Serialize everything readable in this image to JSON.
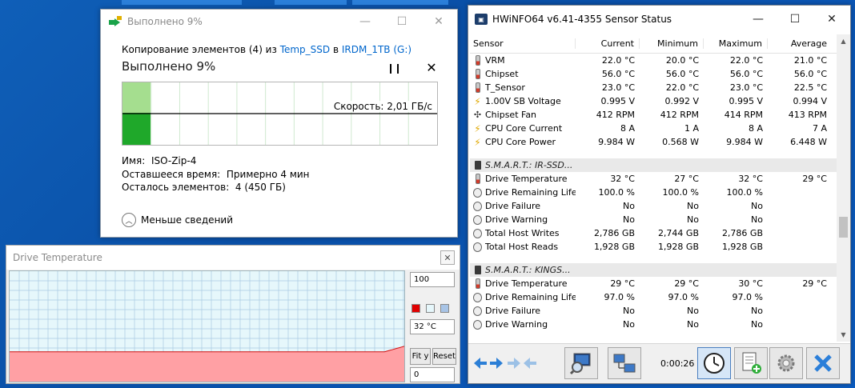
{
  "copy_dialog": {
    "title": "Выполнено 9%",
    "copy_prefix": "Копирование элементов (4) из ",
    "source": "Temp_SSD",
    "copy_mid": " в ",
    "destination": "IRDM_1TB (G:)",
    "heading": "Выполнено 9%",
    "speed": "Скорость: 2,01 ГБ/с",
    "progress": 0.09,
    "name_label": "Имя:",
    "name_value": "ISO-Zip-4",
    "time_label": "Оставшееся время:",
    "time_value": "Примерно 4 мин",
    "items_label": "Осталось элементов:",
    "items_value": "4 (450 ГБ)",
    "less_details": "Меньше сведений"
  },
  "temp_window": {
    "title": "Drive Temperature",
    "max_value": "100",
    "current_value": "32 °C",
    "min_value": "0",
    "fit_label": "Fit y",
    "reset_label": "Reset",
    "colors": {
      "line": "#d01010",
      "fill": "#ffa0a4",
      "background": "#e6f7fb"
    }
  },
  "hwinfo": {
    "title": "HWiNFO64 v6.41-4355 Sensor Status",
    "columns": [
      "Sensor",
      "Current",
      "Minimum",
      "Maximum",
      "Average"
    ],
    "rows": [
      {
        "icon": "thermo",
        "name": "VRM",
        "current": "22.0 °C",
        "min": "20.0 °C",
        "max": "22.0 °C",
        "avg": "21.0 °C"
      },
      {
        "icon": "thermo",
        "name": "Chipset",
        "current": "56.0 °C",
        "min": "56.0 °C",
        "max": "56.0 °C",
        "avg": "56.0 °C"
      },
      {
        "icon": "thermo",
        "name": "T_Sensor",
        "current": "23.0 °C",
        "min": "22.0 °C",
        "max": "23.0 °C",
        "avg": "22.5 °C"
      },
      {
        "icon": "volt",
        "name": "1.00V SB Voltage",
        "current": "0.995 V",
        "min": "0.992 V",
        "max": "0.995 V",
        "avg": "0.994 V"
      },
      {
        "icon": "fan",
        "name": "Chipset Fan",
        "current": "412 RPM",
        "min": "412 RPM",
        "max": "414 RPM",
        "avg": "413 RPM"
      },
      {
        "icon": "volt",
        "name": "CPU Core Current",
        "current": "8 A",
        "min": "1 A",
        "max": "8 A",
        "avg": "7 A"
      },
      {
        "icon": "volt",
        "name": "CPU Core Power",
        "current": "9.984 W",
        "min": "0.568 W",
        "max": "9.984 W",
        "avg": "6.448 W"
      },
      {
        "spacer": true
      },
      {
        "group": true,
        "icon": "drive",
        "name": "S.M.A.R.T.: IR-SSD..."
      },
      {
        "icon": "thermo",
        "name": "Drive Temperature",
        "current": "32 °C",
        "min": "27 °C",
        "max": "32 °C",
        "avg": "29 °C"
      },
      {
        "icon": "circle",
        "name": "Drive Remaining Life",
        "current": "100.0 %",
        "min": "100.0 %",
        "max": "100.0 %",
        "avg": ""
      },
      {
        "icon": "circle",
        "name": "Drive Failure",
        "current": "No",
        "min": "No",
        "max": "No",
        "avg": ""
      },
      {
        "icon": "circle",
        "name": "Drive Warning",
        "current": "No",
        "min": "No",
        "max": "No",
        "avg": ""
      },
      {
        "icon": "circle",
        "name": "Total Host Writes",
        "current": "2,786 GB",
        "min": "2,744 GB",
        "max": "2,786 GB",
        "avg": ""
      },
      {
        "icon": "circle",
        "name": "Total Host Reads",
        "current": "1,928 GB",
        "min": "1,928 GB",
        "max": "1,928 GB",
        "avg": ""
      },
      {
        "spacer": true
      },
      {
        "group": true,
        "icon": "drive",
        "name": "S.M.A.R.T.: KINGS..."
      },
      {
        "icon": "thermo",
        "name": "Drive Temperature",
        "current": "29 °C",
        "min": "29 °C",
        "max": "30 °C",
        "avg": "29 °C"
      },
      {
        "icon": "circle",
        "name": "Drive Remaining Life",
        "current": "97.0 %",
        "min": "97.0 %",
        "max": "97.0 %",
        "avg": ""
      },
      {
        "icon": "circle",
        "name": "Drive Failure",
        "current": "No",
        "min": "No",
        "max": "No",
        "avg": ""
      },
      {
        "icon": "circle",
        "name": "Drive Warning",
        "current": "No",
        "min": "No",
        "max": "No",
        "avg": ""
      }
    ],
    "timer": "0:00:26",
    "toolbar_icons": [
      "collapse-arrows-icon",
      "expand-arrows-icon",
      "magnifier-monitor-icon",
      "network-computers-icon",
      "clock-icon",
      "add-report-icon",
      "settings-gear-icon",
      "close-x-icon"
    ]
  }
}
